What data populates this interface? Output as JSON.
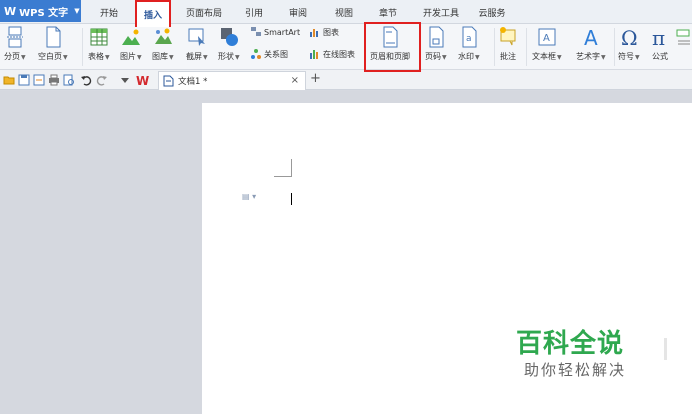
{
  "app": {
    "name": "WPS 文字",
    "logo": "W"
  },
  "menu": {
    "tabs": [
      "开始",
      "插入",
      "页面布局",
      "引用",
      "审阅",
      "视图",
      "章节",
      "开发工具",
      "云服务"
    ],
    "active": "插入"
  },
  "ribbon": {
    "page_break": "分页",
    "blank_page": "空白页",
    "table": "表格",
    "picture": "图片",
    "gallery": "图库",
    "screenshot": "截屏",
    "shape": "形状",
    "smartart": "SmartArt",
    "chart": "图表",
    "relation": "关系图",
    "online_chart": "在线图表",
    "header_footer": "页眉和页脚",
    "page_number": "页码",
    "watermark": "水印",
    "comment": "批注",
    "textbox": "文本框",
    "wordart": "艺术字",
    "symbol": "符号",
    "formula": "公式"
  },
  "tabs_bar": {
    "document_name": "文档1 *",
    "close": "×",
    "new_tab": "+"
  },
  "watermark": {
    "title": "百科全说",
    "subtitle": "助你轻松解决"
  },
  "colors": {
    "brand": "#3b7cd1",
    "highlight": "#e02020",
    "watermark_green": "#2fa84f"
  }
}
